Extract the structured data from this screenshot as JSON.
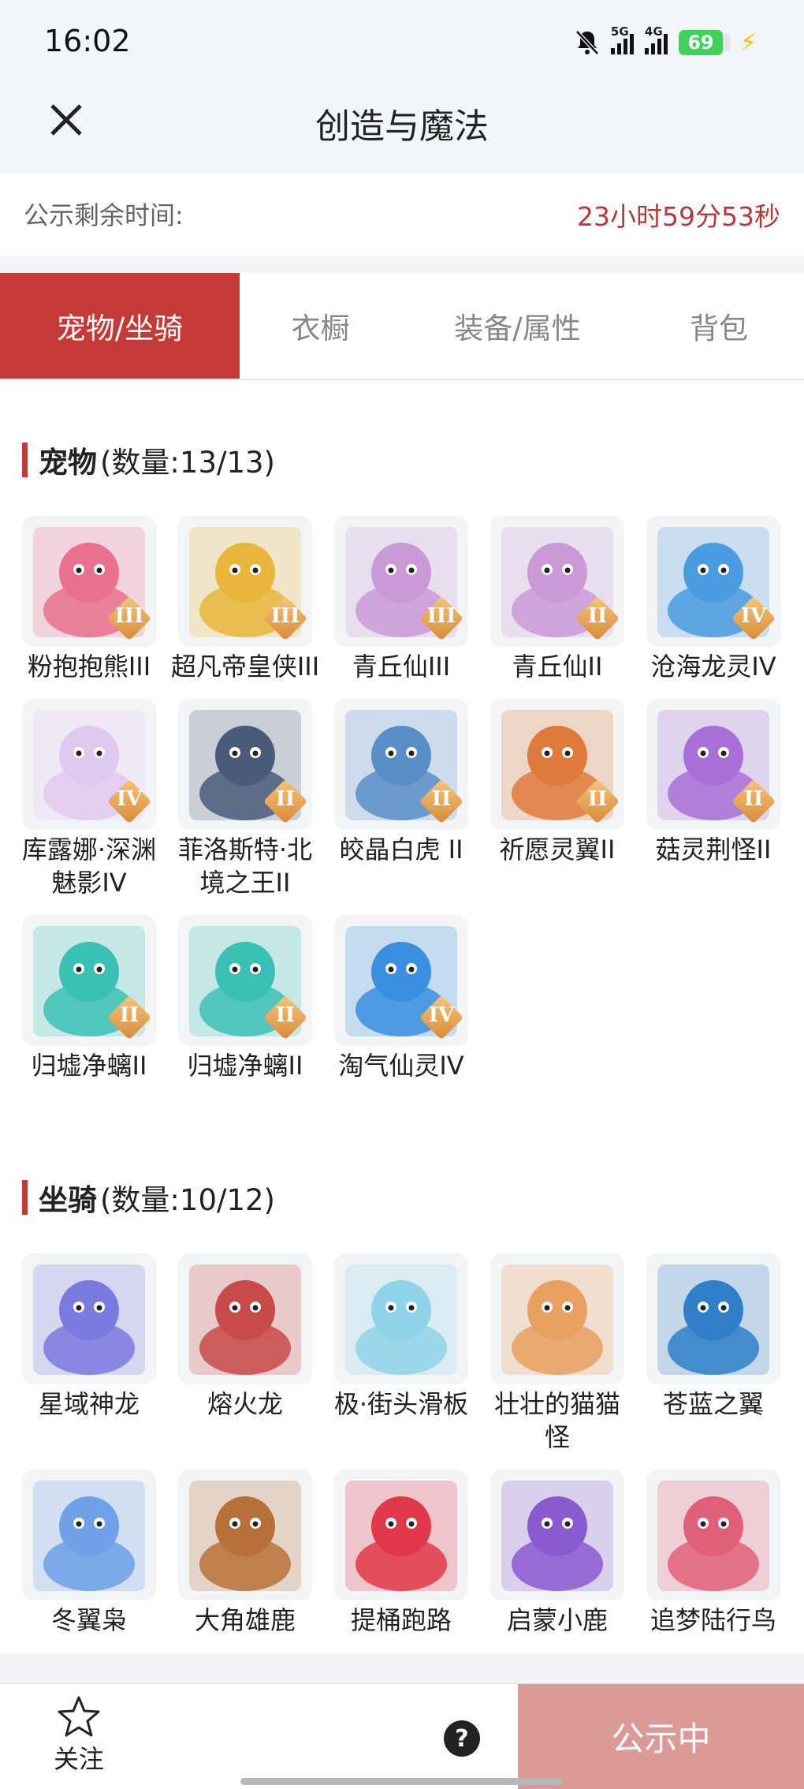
{
  "status_bar": {
    "time": "16:02",
    "net1": "5G",
    "net2": "4G",
    "battery": "69"
  },
  "header": {
    "title": "创造与魔法"
  },
  "countdown": {
    "label": "公示剩余时间:",
    "value": "23小时59分53秒"
  },
  "tabs": [
    {
      "label": "宠物/坐骑",
      "active": true
    },
    {
      "label": "衣橱",
      "active": false
    },
    {
      "label": "装备/属性",
      "active": false
    },
    {
      "label": "背包",
      "active": false
    }
  ],
  "pets": {
    "title": "宠物",
    "count": "(数量:13/13)",
    "items": [
      {
        "name": "粉抱抱熊III",
        "badge": "III",
        "color": "#e9708e"
      },
      {
        "name": "超凡帝皇侠III",
        "badge": "III",
        "color": "#e8b63b"
      },
      {
        "name": "青丘仙III",
        "badge": "III",
        "color": "#c99ad6"
      },
      {
        "name": "青丘仙II",
        "badge": "II",
        "color": "#c99ad6"
      },
      {
        "name": "沧海龙灵IV",
        "badge": "IV",
        "color": "#4a9be0"
      },
      {
        "name": "库露娜·深渊魅影IV",
        "badge": "IV",
        "color": "#e0c9ee"
      },
      {
        "name": "菲洛斯特·北境之王II",
        "badge": "II",
        "color": "#4a5b7a"
      },
      {
        "name": "皎晶白虎 II",
        "badge": "II",
        "color": "#5a8ec7"
      },
      {
        "name": "祈愿灵翼II",
        "badge": "II",
        "color": "#e07a3c"
      },
      {
        "name": "菇灵荆怪II",
        "badge": "II",
        "color": "#a86fd6"
      },
      {
        "name": "归墟净螭II",
        "badge": "II",
        "color": "#3bc0b5"
      },
      {
        "name": "归墟净螭II",
        "badge": "II",
        "color": "#3bc0b5"
      },
      {
        "name": "淘气仙灵IV",
        "badge": "IV",
        "color": "#3a8fe0"
      }
    ]
  },
  "mounts": {
    "title": "坐骑",
    "count": "(数量:10/12)",
    "items": [
      {
        "name": "星域神龙",
        "color": "#7a7ae0"
      },
      {
        "name": "熔火龙",
        "color": "#c84a4a"
      },
      {
        "name": "极·街头滑板",
        "color": "#8fd3e8"
      },
      {
        "name": "壮壮的猫猫怪",
        "color": "#e8a060"
      },
      {
        "name": "苍蓝之翼",
        "color": "#2f7fc8"
      },
      {
        "name": "冬翼枭",
        "color": "#6fa0e8"
      },
      {
        "name": "大角雄鹿",
        "color": "#b8703a"
      },
      {
        "name": "提桶跑路",
        "color": "#e0384a"
      },
      {
        "name": "启蒙小鹿",
        "color": "#8a5ad0"
      },
      {
        "name": "追梦陆行鸟",
        "color": "#e0607a"
      }
    ]
  },
  "bottom": {
    "follow": "关注",
    "help": "?",
    "publish": "公示中"
  }
}
